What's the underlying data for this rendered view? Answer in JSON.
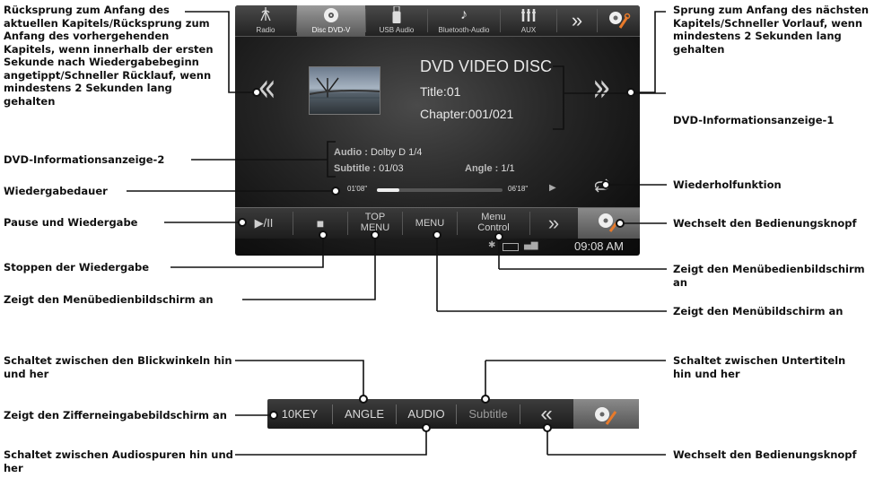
{
  "screen": {
    "tabs": [
      {
        "name": "radio",
        "label": "Radio",
        "icon": "antenna-icon"
      },
      {
        "name": "disc",
        "label": "Disc DVD-V",
        "icon": "disc-icon"
      },
      {
        "name": "usb",
        "label": "USB Audio",
        "icon": "usb-icon"
      },
      {
        "name": "bluetooth",
        "label": "Bluetooth-Audio",
        "icon": "bluetooth-music-icon"
      },
      {
        "name": "aux",
        "label": "AUX",
        "icon": "aux-jack-icon"
      },
      {
        "name": "more",
        "label": "",
        "icon": "double-chevron-right-icon"
      },
      {
        "name": "setup",
        "label": "",
        "icon": "wrench-icon"
      }
    ],
    "disc_title": "DVD VIDEO DISC",
    "title_line": "Title:01",
    "chapter_line": "Chapter:001/021",
    "audio_label": "Audio : ",
    "audio_value": "Dolby D 1/4",
    "subtitle_label": "Subtitle : ",
    "subtitle_value": "01/03",
    "angle_label": "Angle : ",
    "angle_value": "1/1",
    "elapsed": "01'08\"",
    "total": "06'18\"",
    "progress": 0.18,
    "controls": {
      "play_pause": "▶/II",
      "stop": "■",
      "top_menu_1": "TOP",
      "top_menu_2": "MENU",
      "menu": "MENU",
      "menu_control_1": "Menu",
      "menu_control_2": "Control",
      "next_bar": "»"
    },
    "clock": "09:08 AM"
  },
  "bar2": {
    "buttons": [
      "10KEY",
      "ANGLE",
      "AUDIO",
      "Subtitle"
    ],
    "back": "«"
  },
  "annotations": {
    "prev_chapter": "Rücksprung zum Anfang des aktuellen Kapitels/Rücksprung zum Anfang des vorhergehenden Kapitels, wenn innerhalb der ersten Sekunde nach Wiedergabebeginn angetippt/Schneller Rücklauf, wenn mindestens 2 Sekunden lang gehalten",
    "next_chapter": "Sprung zum Anfang des nächsten Kapitels/Schneller Vorlauf, wenn mindestens 2 Sekunden lang gehalten",
    "info1": "DVD-Informationsanzeige-1",
    "info2": "DVD-Informationsanzeige-2",
    "duration": "Wiedergabedauer",
    "repeat": "Wiederholfunktion",
    "play_pause": "Pause und Wiedergabe",
    "switch_bar": "Wechselt den Bedienungsknopf",
    "stop": "Stoppen der Wiedergabe",
    "menu_control": "Zeigt den Menübedienbildschirm an",
    "top_menu": "Zeigt den Menübedienbildschirm an",
    "menu": "Zeigt den Menübildschirm an",
    "angle": "Schaltet zwischen den Blickwinkeln hin und her",
    "subtitle": "Schaltet zwischen Untertiteln hin und her",
    "tenkey": "Zeigt den Zifferneingabebildschirm an",
    "audio": "Schaltet zwischen Audiospuren hin und her",
    "switch_bar2": "Wechselt den Bedienungsknopf"
  }
}
